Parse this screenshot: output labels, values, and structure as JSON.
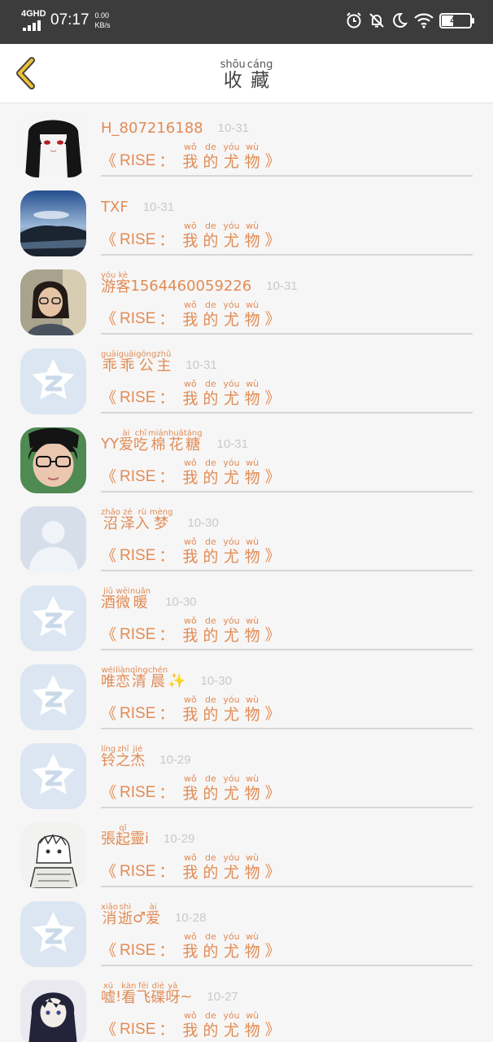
{
  "status_bar": {
    "network": "4GHD",
    "time": "07:17",
    "speed_value": "0.00",
    "speed_unit": "KB/s",
    "battery": "42",
    "battery_percent": 42
  },
  "header": {
    "title_chars": [
      {
        "pinyin": "shōu",
        "char": "收"
      },
      {
        "pinyin": "cáng",
        "char": "藏"
      }
    ],
    "back_icon": "chevron-left-icon"
  },
  "colors": {
    "accent": "#e08c55",
    "status_bar_bg": "#3c3c3c",
    "date": "#c9c9c9",
    "avatar_placeholder": "#dbe6f2"
  },
  "work": {
    "open_quote": "《",
    "title": "RISE",
    "colon": "：",
    "close_quote": "》",
    "chars": [
      {
        "pinyin": "wǒ",
        "char": "我"
      },
      {
        "pinyin": "de",
        "char": "的"
      },
      {
        "pinyin": "yóu",
        "char": "尤"
      },
      {
        "pinyin": "wù",
        "char": "物"
      }
    ]
  },
  "items": [
    {
      "avatar": "anime-girl",
      "name": [
        {
          "text": "H_807216188"
        }
      ],
      "date": "10-31"
    },
    {
      "avatar": "seascape",
      "name": [
        {
          "text": "TXF"
        }
      ],
      "date": "10-31"
    },
    {
      "avatar": "photo-person",
      "name": [
        {
          "pinyin": "yóu",
          "char": "游"
        },
        {
          "pinyin": "kè",
          "char": "客"
        },
        {
          "text": "1564460059226"
        }
      ],
      "date": "10-31"
    },
    {
      "avatar": "qq-default",
      "name": [
        {
          "pinyin": "guāi",
          "char": "乖"
        },
        {
          "pinyin": "guāi",
          "char": "乖"
        },
        {
          "pinyin": "gōng",
          "char": "公"
        },
        {
          "pinyin": "zhǔ",
          "char": "主"
        }
      ],
      "date": "10-31"
    },
    {
      "avatar": "photo-glasses",
      "name": [
        {
          "text": "YY"
        },
        {
          "pinyin": "ài",
          "char": "爱"
        },
        {
          "pinyin": "chī",
          "char": "吃"
        },
        {
          "pinyin": "mián",
          "char": "棉"
        },
        {
          "pinyin": "huā",
          "char": "花"
        },
        {
          "pinyin": "táng",
          "char": "糖"
        }
      ],
      "date": "10-31"
    },
    {
      "avatar": "silhouette",
      "name": [
        {
          "pinyin": "zhǎo",
          "char": "沼"
        },
        {
          "pinyin": "zé",
          "char": "泽"
        },
        {
          "pinyin": "rù",
          "char": "入"
        },
        {
          "pinyin": "mèng",
          "char": "梦"
        }
      ],
      "date": "10-30"
    },
    {
      "avatar": "qq-default",
      "name": [
        {
          "pinyin": "jiǔ",
          "char": "酒"
        },
        {
          "pinyin": "wēi",
          "char": "微"
        },
        {
          "pinyin": "nuǎn",
          "char": "暖"
        }
      ],
      "date": "10-30"
    },
    {
      "avatar": "qq-default",
      "name": [
        {
          "pinyin": "wéi",
          "char": "唯"
        },
        {
          "pinyin": "liàn",
          "char": "恋"
        },
        {
          "pinyin": "qīng",
          "char": "清"
        },
        {
          "pinyin": "chén",
          "char": "晨"
        },
        {
          "text": "✨"
        }
      ],
      "date": "10-30"
    },
    {
      "avatar": "qq-default",
      "name": [
        {
          "pinyin": "líng",
          "char": "铃"
        },
        {
          "pinyin": "zhī",
          "char": "之"
        },
        {
          "pinyin": "jié",
          "char": "杰"
        }
      ],
      "date": "10-29"
    },
    {
      "avatar": "sketch",
      "name": [
        {
          "text": "張"
        },
        {
          "pinyin": "qǐ",
          "char": "起"
        },
        {
          "text": "靈"
        },
        {
          "text": "i"
        }
      ],
      "date": "10-29"
    },
    {
      "avatar": "qq-default",
      "name": [
        {
          "pinyin": "xiāo",
          "char": "消"
        },
        {
          "pinyin": "shì",
          "char": "逝"
        },
        {
          "text": "♂"
        },
        {
          "pinyin": "ài",
          "char": "爱"
        }
      ],
      "date": "10-28"
    },
    {
      "avatar": "anime-dark",
      "name": [
        {
          "pinyin": "xū",
          "char": "嘘"
        },
        {
          "text": "!"
        },
        {
          "pinyin": "kàn",
          "char": "看"
        },
        {
          "pinyin": "fēi",
          "char": "飞"
        },
        {
          "pinyin": "dié",
          "char": "碟"
        },
        {
          "pinyin": "yā",
          "char": "呀"
        },
        {
          "text": "~"
        }
      ],
      "date": "10-27"
    }
  ]
}
